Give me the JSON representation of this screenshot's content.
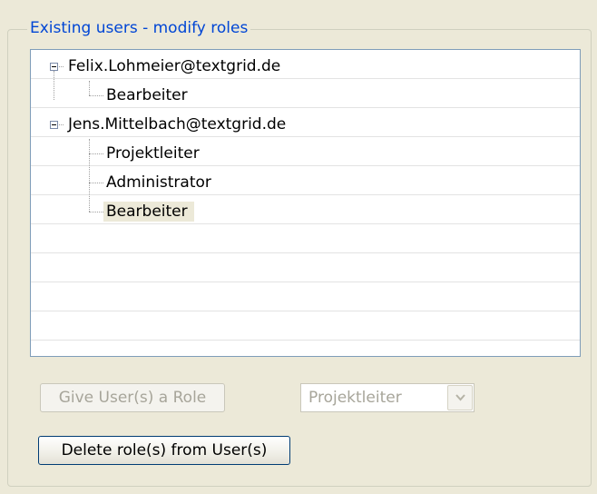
{
  "group": {
    "title": "Existing users - modify roles"
  },
  "tree": {
    "users": [
      {
        "email": "Felix.Lohmeier@textgrid.de",
        "expanded": true,
        "roles": [
          {
            "label": "Bearbeiter",
            "selected": false
          }
        ]
      },
      {
        "email": "Jens.Mittelbach@textgrid.de",
        "expanded": true,
        "roles": [
          {
            "label": "Projektleiter",
            "selected": false
          },
          {
            "label": "Administrator",
            "selected": false
          },
          {
            "label": "Bearbeiter",
            "selected": true
          }
        ]
      }
    ]
  },
  "actions": {
    "give_role_label": "Give User(s) a Role",
    "give_role_enabled": false,
    "role_select_value": "Projektleiter",
    "role_select_enabled": false,
    "delete_role_label": "Delete role(s) from User(s)",
    "delete_role_enabled": true
  },
  "colors": {
    "window_background": "#ece9d8",
    "group_title": "#0046d5",
    "tree_border": "#7f9db9",
    "selection_background": "#ece9d8",
    "disabled_text": "#a7a59a"
  }
}
